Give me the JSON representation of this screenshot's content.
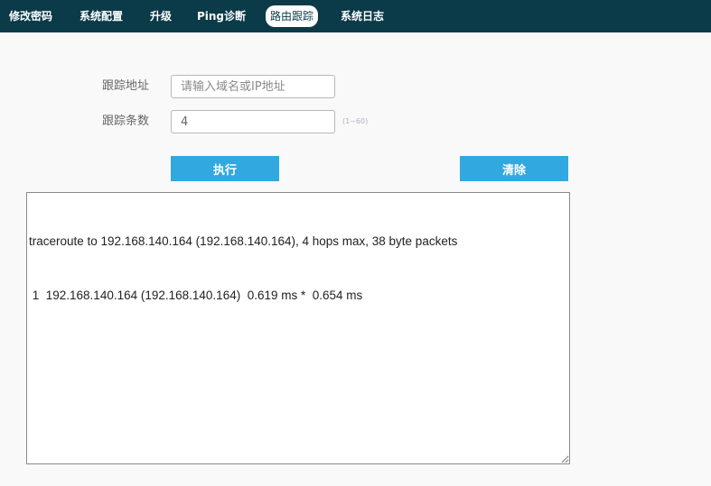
{
  "nav": {
    "items": [
      {
        "label": "修改密码",
        "active": false
      },
      {
        "label": "系统配置",
        "active": false
      },
      {
        "label": "升级",
        "active": false
      },
      {
        "label": "Ping诊断",
        "active": false
      },
      {
        "label": "路由跟踪",
        "active": true
      },
      {
        "label": "系统日志",
        "active": false
      }
    ]
  },
  "form": {
    "address_label": "跟踪地址",
    "address_placeholder": "请输入域名或IP地址",
    "address_value": "",
    "count_label": "跟踪条数",
    "count_value": "4",
    "count_hint": "(1~60)"
  },
  "buttons": {
    "execute_label": "执行",
    "clear_label": "清除"
  },
  "output": {
    "lines": [
      "traceroute to 192.168.140.164 (192.168.140.164), 4 hops max, 38 byte packets",
      " 1  192.168.140.164 (192.168.140.164)  0.619 ms *  0.654 ms"
    ]
  },
  "colors": {
    "navbar_bg": "#0b3a48",
    "button_bg": "#31a8df"
  }
}
